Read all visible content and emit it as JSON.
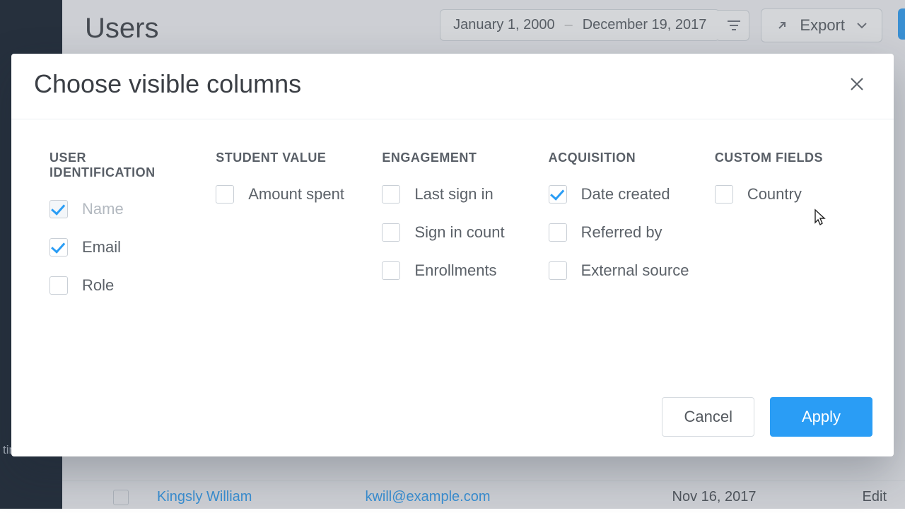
{
  "sidebar": {
    "visible_item": "tings"
  },
  "header": {
    "title": "Users",
    "date_from": "January 1, 2000",
    "date_to": "December 19, 2017",
    "date_sep": "–",
    "export_label": "Export"
  },
  "table_peek": {
    "name": "Kingsly William",
    "email": "kwill@example.com",
    "date": "Nov 16, 2017",
    "edit": "Edit"
  },
  "modal": {
    "title": "Choose visible columns",
    "cancel": "Cancel",
    "apply": "Apply",
    "groups": [
      {
        "heading": "USER IDENTIFICATION",
        "items": [
          {
            "label": "Name",
            "checked": true,
            "locked": true
          },
          {
            "label": "Email",
            "checked": true,
            "locked": false
          },
          {
            "label": "Role",
            "checked": false,
            "locked": false
          }
        ]
      },
      {
        "heading": "STUDENT VALUE",
        "items": [
          {
            "label": "Amount spent",
            "checked": false,
            "locked": false
          }
        ]
      },
      {
        "heading": "ENGAGEMENT",
        "items": [
          {
            "label": "Last sign in",
            "checked": false,
            "locked": false
          },
          {
            "label": "Sign in count",
            "checked": false,
            "locked": false
          },
          {
            "label": "Enrollments",
            "checked": false,
            "locked": false
          }
        ]
      },
      {
        "heading": "ACQUISITION",
        "items": [
          {
            "label": "Date created",
            "checked": true,
            "locked": false
          },
          {
            "label": "Referred by",
            "checked": false,
            "locked": false
          },
          {
            "label": "External source",
            "checked": false,
            "locked": false
          }
        ]
      },
      {
        "heading": "CUSTOM FIELDS",
        "items": [
          {
            "label": "Country",
            "checked": false,
            "locked": false
          }
        ]
      }
    ]
  }
}
